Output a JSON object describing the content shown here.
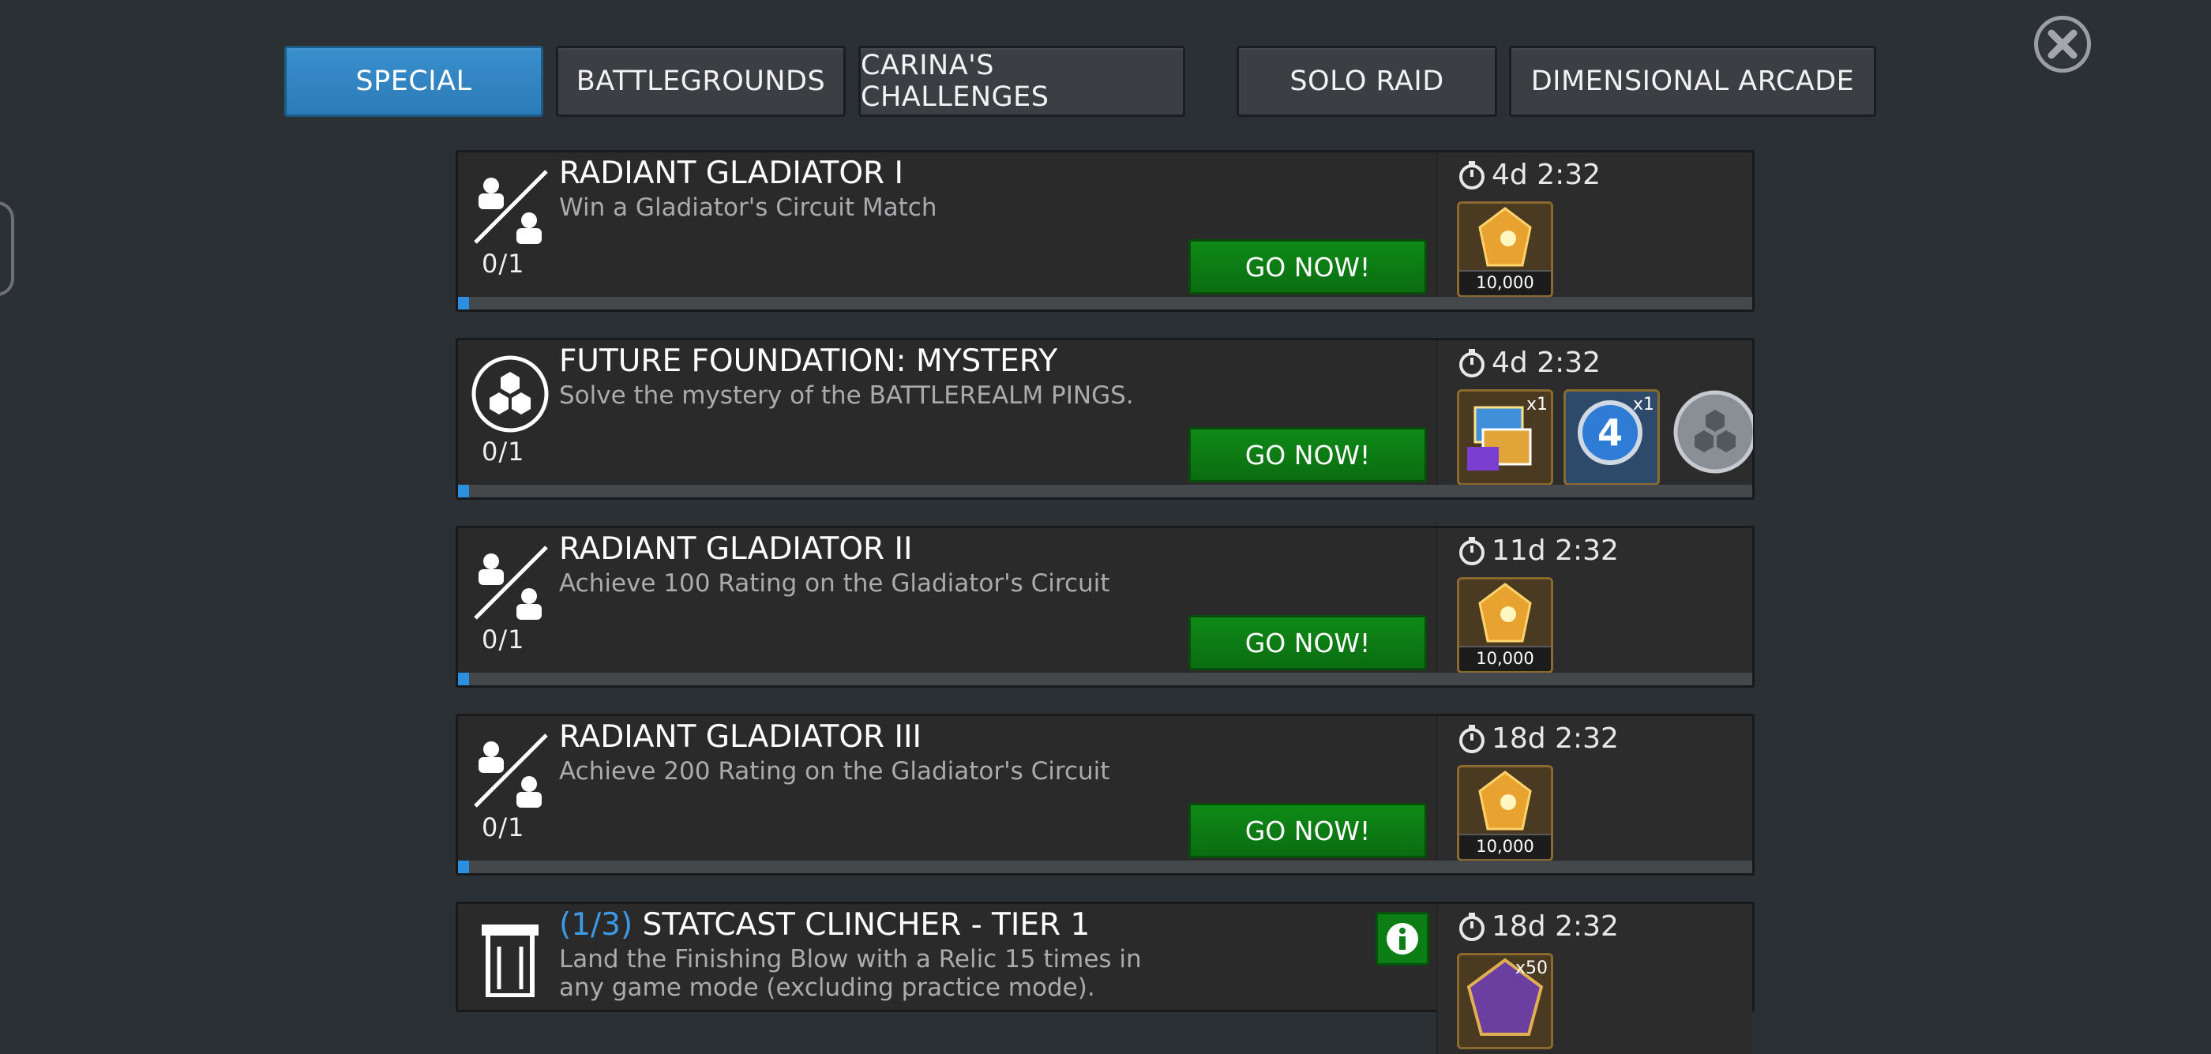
{
  "tabs": [
    {
      "label": "SPECIAL",
      "active": true
    },
    {
      "label": "BATTLEGROUNDS",
      "active": false
    },
    {
      "label": "CARINA'S CHALLENGES",
      "active": false
    },
    {
      "label": "SOLO RAID",
      "active": false
    },
    {
      "label": "DIMENSIONAL ARCADE",
      "active": false
    }
  ],
  "close_icon": "close-icon",
  "quests": [
    {
      "icon": "gladiator-icon",
      "title": "RADIANT GLADIATOR I",
      "description": "Win a Gladiator's Circuit Match",
      "progress": "0/1",
      "progress_fraction": 0,
      "button": "GO NOW!",
      "timer": "4d 2:32",
      "rewards": [
        {
          "icon": "gold-crystal-icon",
          "amount": "10,000"
        }
      ]
    },
    {
      "icon": "future-foundation-icon",
      "title": "FUTURE FOUNDATION: MYSTERY",
      "description": "Solve the mystery of the BATTLEREALM PINGS.",
      "progress": "0/1",
      "progress_fraction": 0,
      "button": "GO NOW!",
      "timer": "4d 2:32",
      "rewards": [
        {
          "icon": "crate-bundle-icon",
          "multiplier": "x1"
        },
        {
          "icon": "fantastic-four-badge-icon",
          "multiplier": "x1"
        },
        {
          "icon": "hexagon-token-icon"
        }
      ]
    },
    {
      "icon": "gladiator-icon",
      "title": "RADIANT GLADIATOR II",
      "description": "Achieve 100 Rating on the Gladiator's Circuit",
      "progress": "0/1",
      "progress_fraction": 0,
      "button": "GO NOW!",
      "timer": "11d 2:32",
      "rewards": [
        {
          "icon": "gold-crystal-icon",
          "amount": "10,000"
        }
      ]
    },
    {
      "icon": "gladiator-icon",
      "title": "RADIANT GLADIATOR III",
      "description": "Achieve 200 Rating on the Gladiator's Circuit",
      "progress": "0/1",
      "progress_fraction": 0,
      "button": "GO NOW!",
      "timer": "18d 2:32",
      "rewards": [
        {
          "icon": "gold-crystal-icon",
          "amount": "10,000"
        }
      ]
    },
    {
      "icon": "relic-tower-icon",
      "title_prefix": "(1/3)",
      "title": "STATCAST CLINCHER - TIER 1",
      "description": "Land the Finishing Blow with a Relic 15 times in any game mode (excluding practice mode).",
      "timer": "18d 2:32",
      "info_icon": "info-icon",
      "rewards": [
        {
          "icon": "event-token-icon",
          "multiplier": "x50"
        }
      ]
    }
  ],
  "colors": {
    "background": "#2b3035",
    "tab_active": "#2b7bb8",
    "go_button": "#0b6d11",
    "progress_fill": "#2d8fe0",
    "title_prefix": "#3f9ae6"
  }
}
